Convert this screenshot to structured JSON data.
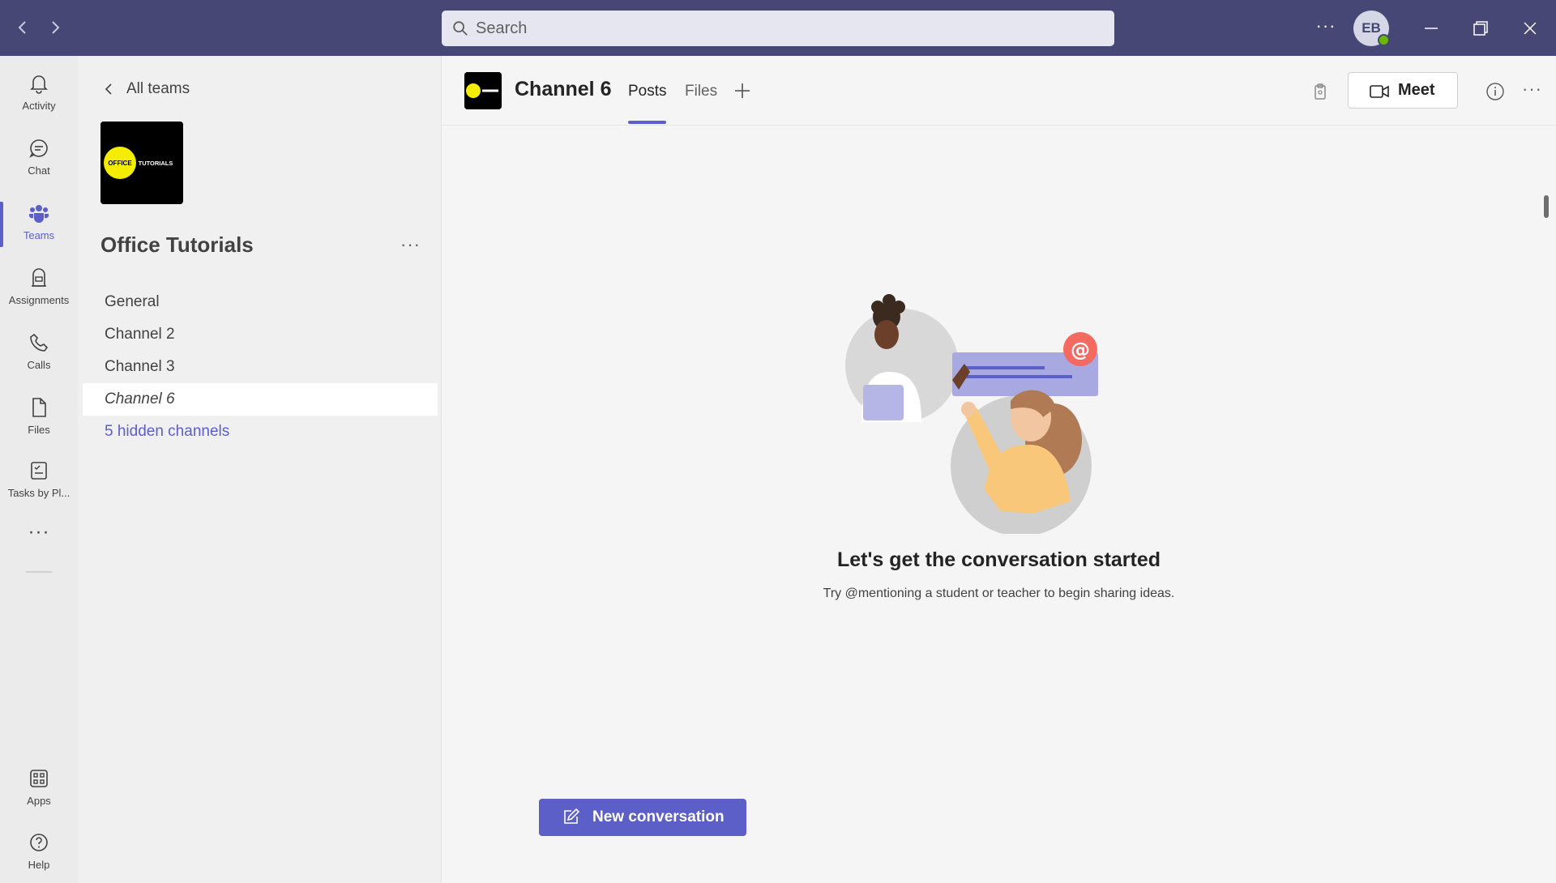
{
  "titlebar": {
    "search_placeholder": "Search",
    "more_label": "···",
    "avatar_initials": "EB"
  },
  "rail": {
    "items": [
      {
        "label": "Activity",
        "icon": "bell-icon"
      },
      {
        "label": "Chat",
        "icon": "chat-icon"
      },
      {
        "label": "Teams",
        "icon": "teams-icon"
      },
      {
        "label": "Assignments",
        "icon": "assignments-icon"
      },
      {
        "label": "Calls",
        "icon": "phone-icon"
      },
      {
        "label": "Files",
        "icon": "file-icon"
      },
      {
        "label": "Tasks by Pl...",
        "icon": "tasks-icon"
      },
      {
        "label": "Apps",
        "icon": "apps-icon"
      },
      {
        "label": "Help",
        "icon": "help-icon"
      }
    ],
    "active": "Teams",
    "more_label": "···"
  },
  "sidebar": {
    "back_label": "All teams",
    "team_name": "Office Tutorials",
    "team_more": "···",
    "channels": [
      "General",
      "Channel 2",
      "Channel 3",
      "Channel 6"
    ],
    "active_channel": "Channel 6",
    "hidden_channels": "5 hidden channels",
    "logo_text_left": "OFFICE",
    "logo_text_right": "TUTORIALS"
  },
  "header": {
    "channel_title": "Channel 6",
    "tabs": [
      "Posts",
      "Files"
    ],
    "active_tab": "Posts",
    "meet_label": "Meet",
    "more_label": "···"
  },
  "main": {
    "empty_title": "Let's get the conversation started",
    "empty_subtitle": "Try @mentioning a student or teacher to begin sharing ideas.",
    "new_conversation_label": "New conversation"
  },
  "colors": {
    "titlebar": "#464775",
    "accent": "#5b5fc7",
    "logo_yellow": "#f4ed00"
  }
}
